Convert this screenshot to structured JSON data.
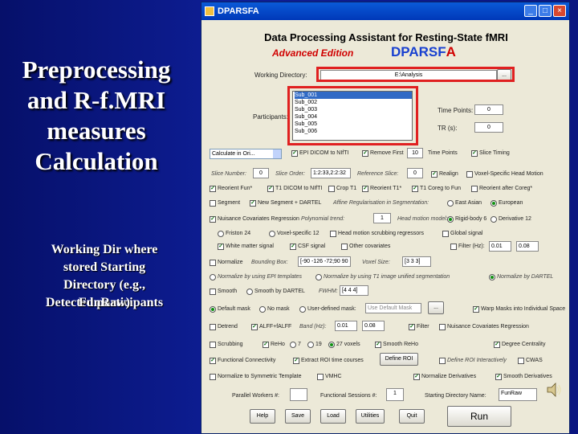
{
  "slide": {
    "title_lines": [
      "Preprocessing",
      "and R-f.MRI",
      "measures",
      "Calculation"
    ],
    "note_lines": [
      "Working Dir where",
      "stored Starting",
      "Directory (e.g.,",
      "Detected participants"
    ],
    "note_overlap": "FunRaw)"
  },
  "window": {
    "app_title": "DPARSFA",
    "heading": "Data Processing Assistant for Resting-State fMRI",
    "edition": "Advanced Edition",
    "brand_main": "DPARSF",
    "brand_suffix": "A"
  },
  "form": {
    "working_dir_label": "Working Directory:",
    "working_dir_value": "E:\\Analysis",
    "browse": "...",
    "participants_label": "Participants:",
    "participants": [
      "Sub_001",
      "Sub_002",
      "Sub_003",
      "Sub_004",
      "Sub_005",
      "Sub_006"
    ],
    "time_points_label": "Time Points:",
    "time_points_value": "0",
    "tr_label": "TR (s):",
    "tr_value": "0",
    "template_select": "Calculate in Ori...",
    "dicom": "EPI DICOM to NIfTI",
    "remove_first": "Remove First",
    "remove_value": "10",
    "time_points_short": "Time Points",
    "slice_timing": "Slice Timing",
    "slice_number": "Slice Number:",
    "slice_number_value": "0",
    "slice_order": "Slice Order:",
    "slice_order_value": "1:2:33,2:2:32",
    "ref_slice": "Reference Slice:",
    "ref_slice_value": "0",
    "realign": "Realign",
    "voxel_head": "Voxel-Specific Head Motion",
    "reorient_fun": "Reorient Fun*",
    "t1_dicom": "T1 DICOM to NIfTI",
    "crop_t1": "Crop T1",
    "reorient_t1": "Reorient T1*",
    "t1_coreg": "T1 Coreg to Fun",
    "reorient_interactively": "Reorient after Coreg*",
    "segment": "Segment",
    "new_segment": "New Segment + DARTEL",
    "affine_reg": "Affine Regularisation in Segmentation:",
    "east_asian": "East Asian",
    "european": "European",
    "nuisance": "Nuisance Covariates Regression",
    "poly_trend": "Polynomial trend:",
    "poly_value": "1",
    "head_motion": "Head motion model:",
    "friston6": "Rigid-body 6",
    "deriv12": "Derivative 12",
    "friston24": "Friston 24",
    "voxel_friston": "Voxel-specific 12",
    "head_scrub": "Head motion scrubbing regressors",
    "global_signal": "Global signal",
    "wm": "White matter signal",
    "csf": "CSF signal",
    "other_cov": "Other covariates",
    "filter_hz": "Filter (Hz):",
    "filter_lo": "0.01",
    "filter_hi": "0.08",
    "normalize": "Normalize",
    "bbox_label": "Bounding Box:",
    "bbox_value": "[-90 -126 -72;90 90 108]",
    "voxel_size": "Voxel Size:",
    "voxel_value": "[3 3 3]",
    "norm_epi": "Normalize by using EPI templates",
    "norm_t1": "Normalize by using T1 image unified segmentation",
    "norm_dartel": "Normalize by DARTEL",
    "smooth": "Smooth",
    "smooth_dartel": "Smooth by DARTEL",
    "fwhm": "FWHM:",
    "fwhm_value": "[4 4 4]",
    "default_mask": "Default mask",
    "no_mask": "No mask",
    "user_mask": "User-defined mask:",
    "use_default_mask": "Use Default Mask",
    "warp_masks": "Warp Masks into Individual Space",
    "detrend": "Detrend",
    "alff": "ALFF+fALFF",
    "band_label": "Band (Hz):",
    "band_lo": "0.01",
    "band_hi": "0.08",
    "filter": "Filter",
    "nuis_after": "Nuisance Covariates Regression",
    "scrubbing": "Scrubbing",
    "reho": "ReHo",
    "reho7": "7",
    "reho19": "19",
    "reho27": "27 voxels",
    "smooth_reho": "Smooth ReHo",
    "degree": "Degree Centrality",
    "fc": "Functional Connectivity",
    "roi_tc": "Extract ROI time courses",
    "define_roi": "Define ROI",
    "roi_interactive": "Define ROI Interactively",
    "vmhc_label": "VMHC",
    "cwas": "CWAS",
    "norm_sym": "Normalize to Symmetric Template",
    "vmhc": "VMHC",
    "norm_deriv": "Normalize Derivatives",
    "smooth_deriv": "Smooth Derivatives",
    "parallel": "Parallel Workers #:",
    "sessions": "Functional Sessions #:",
    "sessions_value": "1",
    "start_dir": "Starting Directory Name:",
    "start_dir_value": "FunRaw",
    "btn_help": "Help",
    "btn_save": "Save",
    "btn_load": "Load",
    "btn_utilities": "Utilities",
    "btn_quit": "Quit",
    "btn_run": "Run"
  }
}
